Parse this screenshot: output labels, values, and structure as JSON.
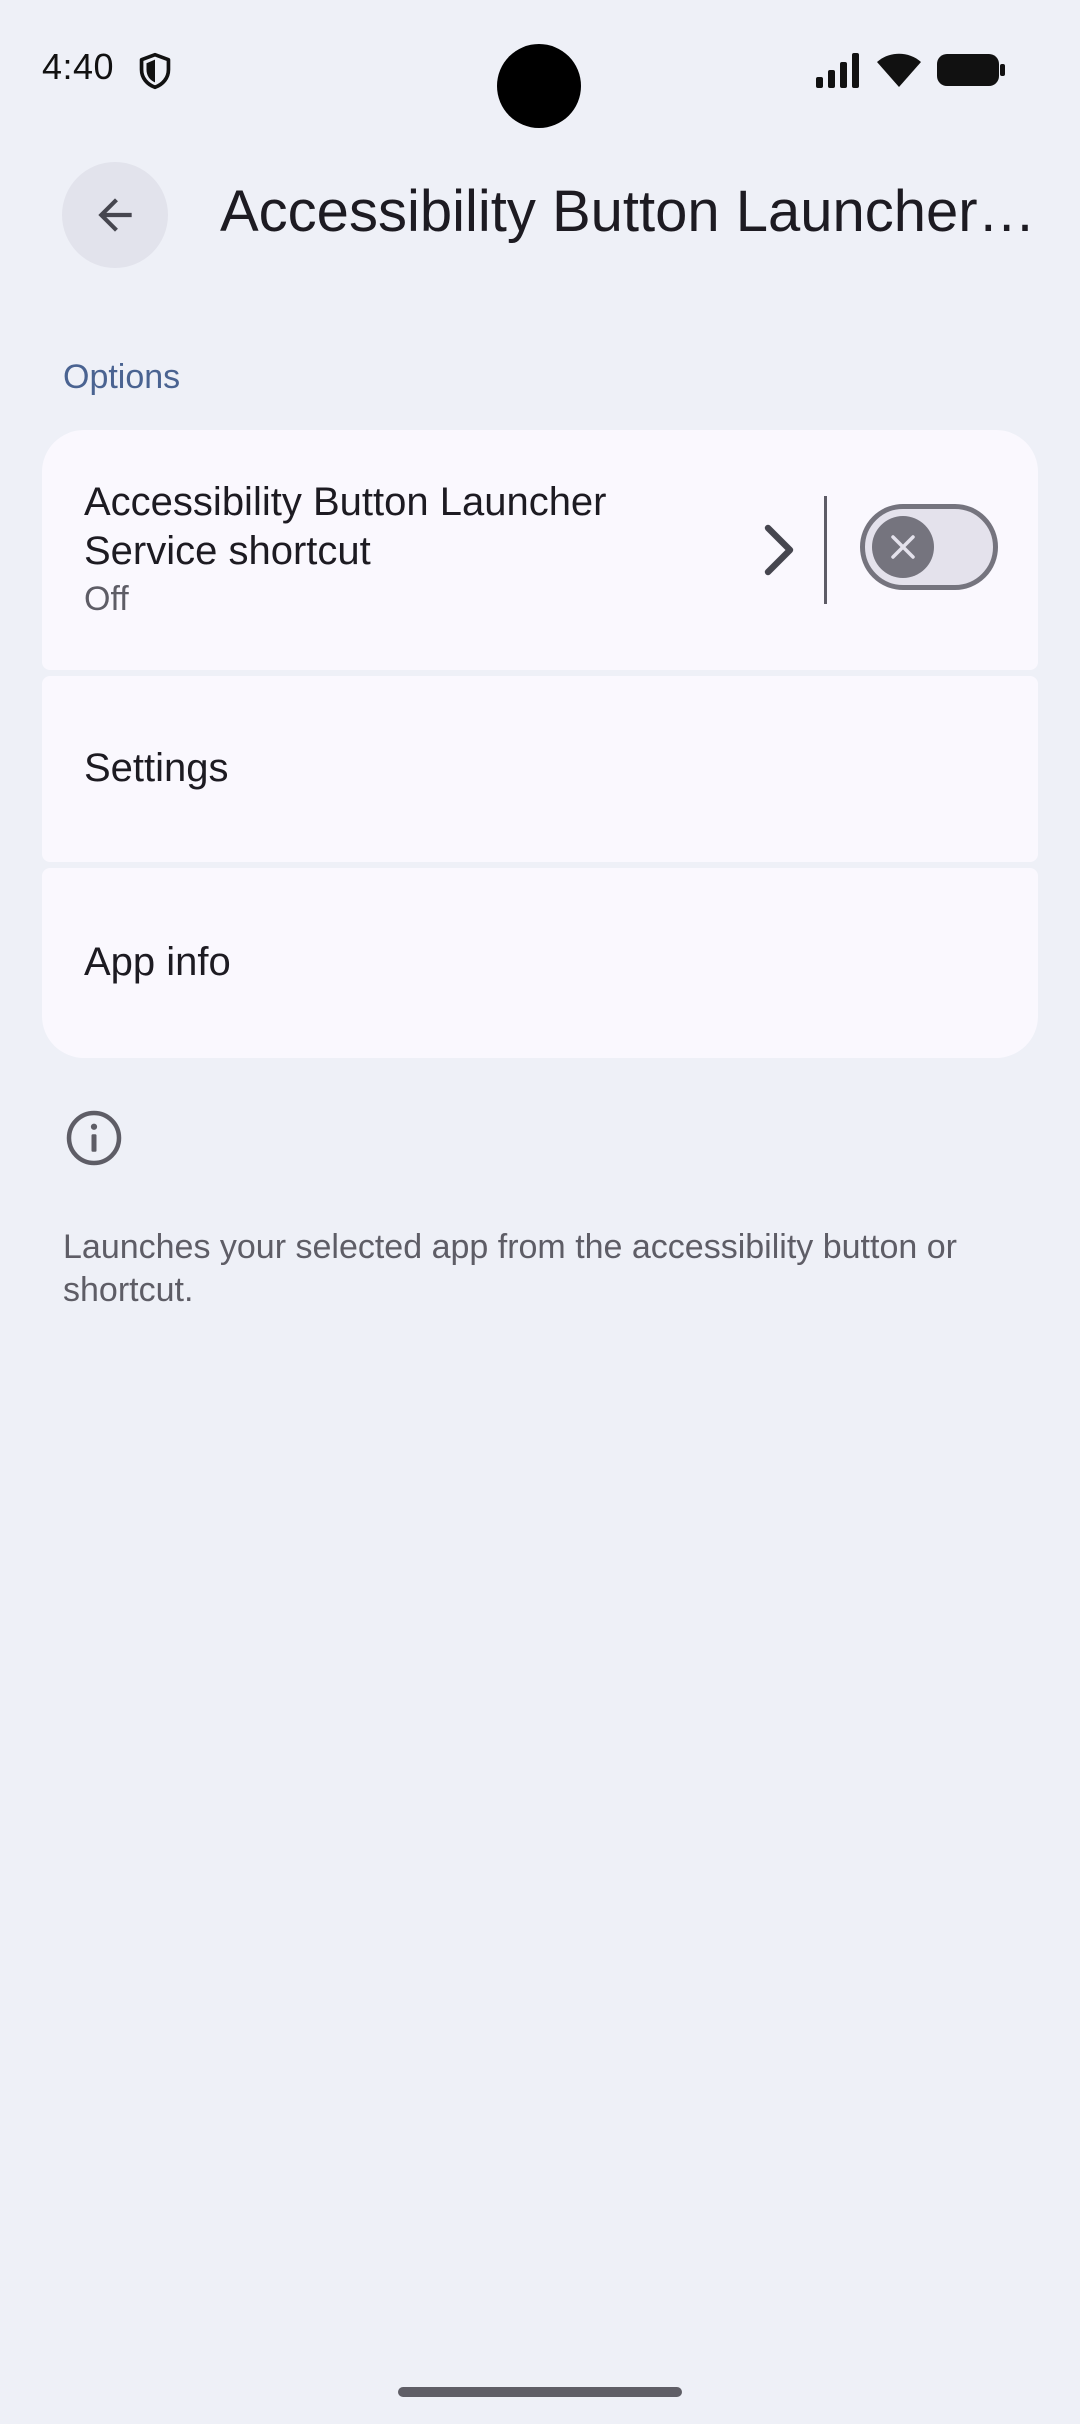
{
  "status_bar": {
    "time": "4:40",
    "icons": [
      "shield-icon",
      "signal-icon",
      "wifi-icon",
      "battery-icon"
    ]
  },
  "app_bar": {
    "back_icon": "arrow-back-icon",
    "title": "Accessibility Button Launcher Service"
  },
  "section": {
    "header": "Options"
  },
  "shortcut_item": {
    "title": "Accessibility Button Launcher Service shortcut",
    "summary": "Off",
    "toggle_checked": false,
    "chevron_icon": "chevron-right-icon"
  },
  "settings_item": {
    "label": "Settings"
  },
  "app_info_item": {
    "label": "App info"
  },
  "footer": {
    "icon": "info-icon",
    "text": "Launches your selected app from the accessibility button or shortcut."
  },
  "colors": {
    "background": "#eef0f7",
    "card": "#faf8fe",
    "accent": "#4a6391",
    "toggle_off": "#75747e"
  }
}
